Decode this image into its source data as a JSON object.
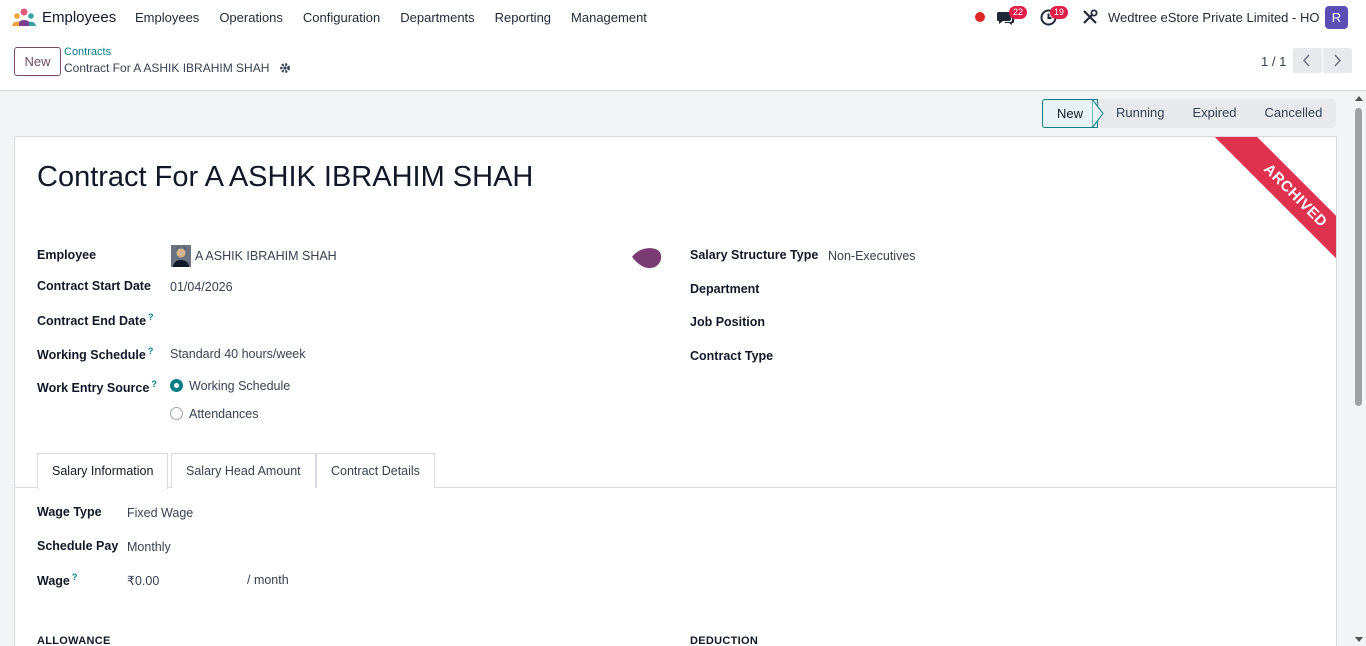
{
  "app": {
    "name": "Employees"
  },
  "menu": [
    "Employees",
    "Operations",
    "Configuration",
    "Departments",
    "Reporting",
    "Management"
  ],
  "systray": {
    "messages_count": "22",
    "activities_count": "19",
    "company": "Wedtree eStore Private Limited - HO",
    "user_initial": "R"
  },
  "control": {
    "new_label": "New",
    "breadcrumb_parent": "Contracts",
    "breadcrumb_current": "Contract For A ASHIK IBRAHIM SHAH",
    "pager": "1 / 1"
  },
  "status": {
    "stages": [
      "New",
      "Running",
      "Expired",
      "Cancelled"
    ],
    "active": "New"
  },
  "form": {
    "title": "Contract For A ASHIK IBRAHIM SHAH",
    "ribbon": "ARCHIVED",
    "left": {
      "employee_label": "Employee",
      "employee_value": "A ASHIK IBRAHIM SHAH",
      "start_label": "Contract Start Date",
      "start_value": "01/04/2026",
      "end_label": "Contract End Date",
      "end_value": "",
      "schedule_label": "Working Schedule",
      "schedule_value": "Standard 40 hours/week",
      "source_label": "Work Entry Source",
      "source_options": [
        "Working Schedule",
        "Attendances"
      ],
      "source_selected": "Working Schedule"
    },
    "right": {
      "structure_label": "Salary Structure Type",
      "structure_value": "Non-Executives",
      "department_label": "Department",
      "department_value": "",
      "job_label": "Job Position",
      "job_value": "",
      "type_label": "Contract Type",
      "type_value": ""
    },
    "tooltip_mark": "?"
  },
  "tabs": [
    "Salary Information",
    "Salary Head Amount",
    "Contract Details"
  ],
  "salary": {
    "wage_type_label": "Wage Type",
    "wage_type_value": "Fixed Wage",
    "schedule_pay_label": "Schedule Pay",
    "schedule_pay_value": "Monthly",
    "wage_label": "Wage",
    "wage_value": "₹0.00",
    "wage_unit": "/ month",
    "allowance_head": "ALLOWANCE",
    "deduction_head": "DEDUCTION"
  },
  "colors": {
    "brand": "#714b67",
    "accent": "#017e84",
    "ribbon": "#e0324f"
  }
}
